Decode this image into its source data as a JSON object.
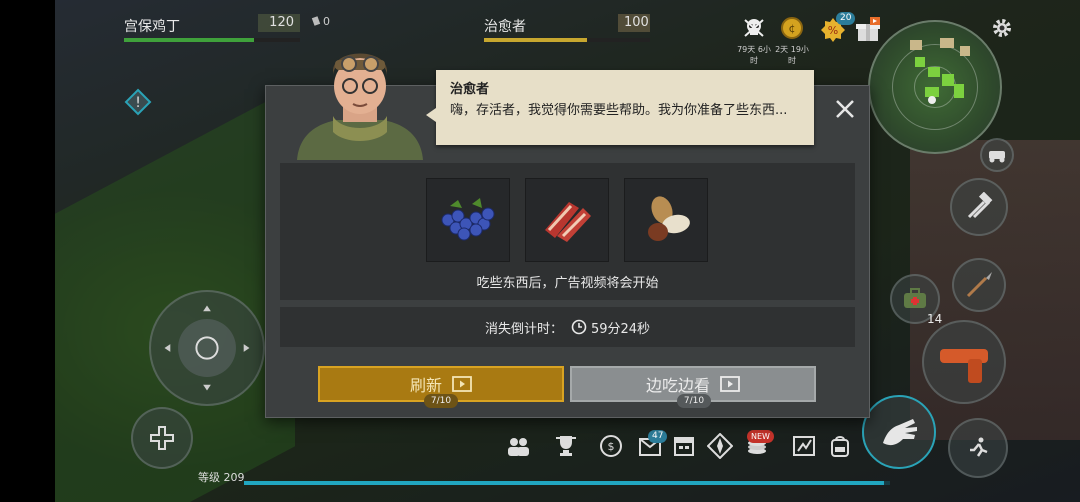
{
  "player": {
    "name": "宫保鸡丁",
    "health": "120",
    "ammo": "0",
    "health_fill": 0.74
  },
  "npc_hud": {
    "name": "治愈者",
    "value": "100",
    "fill": 0.62
  },
  "top_stats": {
    "skull_caption": "79天 6小时",
    "coin_caption": "2天 19小时",
    "discount_badge": "20"
  },
  "dialog": {
    "speaker": "治愈者",
    "message": "嗨，存活者，我觉得你需要些帮助。我为你准备了些东西...",
    "rewards": [
      {
        "icon": "blueberries-icon"
      },
      {
        "icon": "bacon-icon"
      },
      {
        "icon": "nuts-icon"
      }
    ],
    "reward_note": "吃些东西后，广告视频将会开始",
    "countdown_label": "消失倒计时：",
    "countdown_value": "59分24秒",
    "refresh_label": "刷新",
    "refresh_count": "7/10",
    "watch_label": "边吃边看",
    "watch_count": "7/10"
  },
  "weapon_ammo": "14",
  "toolbar": {
    "mail_badge": "47",
    "new_badge": "NEW"
  },
  "level": {
    "label": "等级 209",
    "progress": 0.99
  },
  "colors": {
    "gold": "#a97a12",
    "health_green": "#3fa13b",
    "npc_yellow": "#c7a72f",
    "xp_cyan": "#21a6c0"
  }
}
